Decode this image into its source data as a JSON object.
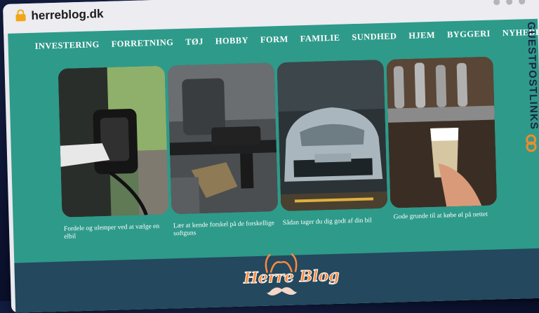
{
  "browser": {
    "url": "herreblog.dk"
  },
  "nav": {
    "items": [
      "INVESTERING",
      "FORRETNING",
      "TØJ",
      "HOBBY",
      "FORM",
      "FAMILIE",
      "SUNDHED",
      "HJEM",
      "BYGGERI",
      "NYHEDER"
    ]
  },
  "side_logo": {
    "text": "GUESTPOSTLINKS"
  },
  "articles": [
    {
      "caption": "Fordele og ulemper ved at vælge en elbil"
    },
    {
      "caption": "Lær at kende forskel på de forskellige softguns"
    },
    {
      "caption": "Sådan tager du dig godt af din bil"
    },
    {
      "caption": "Gode grunde til at købe øl på nettet"
    }
  ],
  "footer": {
    "logo_text": "Herre Blog"
  },
  "colors": {
    "page_bg": "#2e9a8a",
    "footer_bg": "#24485d",
    "accent": "#f2a516"
  }
}
